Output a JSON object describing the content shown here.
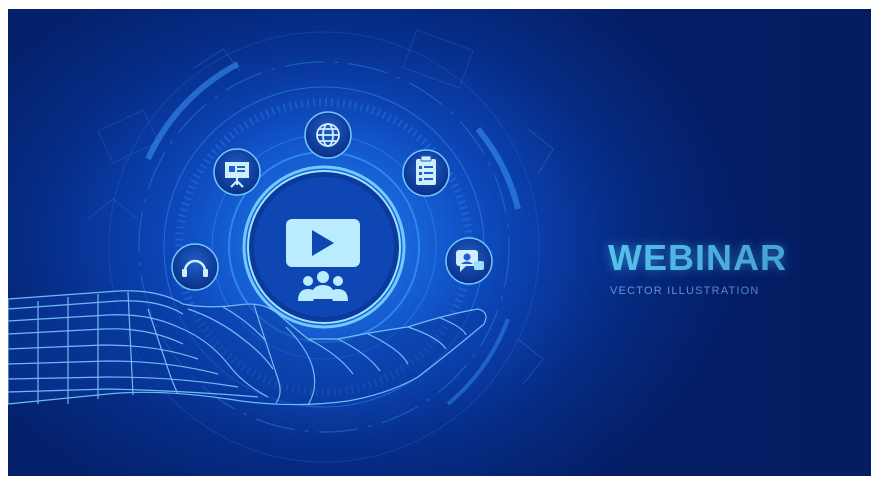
{
  "banner": {
    "title": "WEBINAR",
    "subtitle": "VECTOR ILLUSTRATION"
  },
  "palette": {
    "background_deep": "#04206a",
    "background_mid": "#0c45b8",
    "glow": "#1a6fe6",
    "accent": "#5fd8ff",
    "line": "#3fa0ff"
  },
  "icons": [
    "headset-icon",
    "presentation-icon",
    "globe-icon",
    "clipboard-icon",
    "chat-icon",
    "video-play-icon",
    "people-group-icon",
    "robot-hand"
  ]
}
